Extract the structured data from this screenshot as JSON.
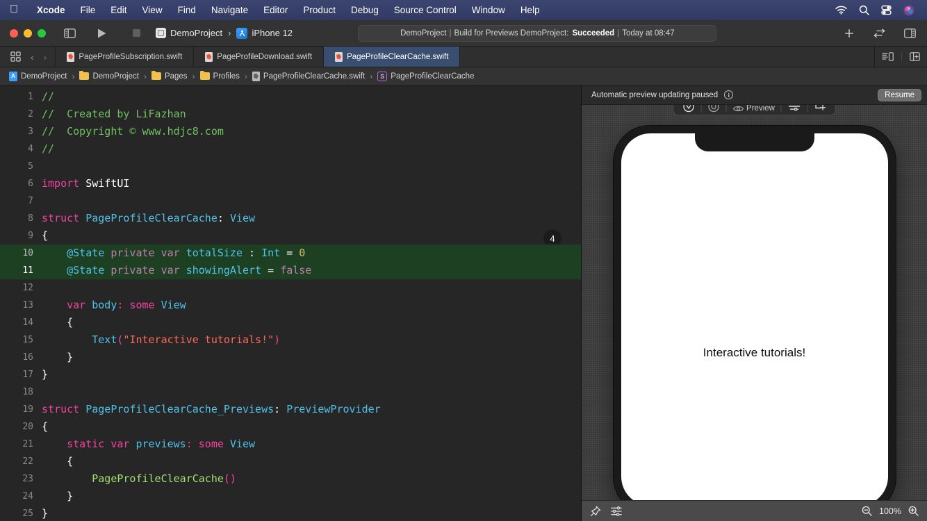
{
  "menubar": {
    "apple_icon": "apple-logo-icon",
    "items": [
      {
        "label": "Xcode",
        "bold": true
      },
      {
        "label": "File",
        "bold": false
      },
      {
        "label": "Edit",
        "bold": false
      },
      {
        "label": "View",
        "bold": false
      },
      {
        "label": "Find",
        "bold": false
      },
      {
        "label": "Navigate",
        "bold": false
      },
      {
        "label": "Editor",
        "bold": false
      },
      {
        "label": "Product",
        "bold": false
      },
      {
        "label": "Debug",
        "bold": false
      },
      {
        "label": "Source Control",
        "bold": false
      },
      {
        "label": "Window",
        "bold": false
      },
      {
        "label": "Help",
        "bold": false
      }
    ],
    "status_icons": [
      "wifi-icon",
      "search-icon",
      "control-center-icon",
      "siri-icon"
    ],
    "background": "#3b4570"
  },
  "toolbar": {
    "window_controls": [
      "close-button",
      "minimize-button",
      "zoom-button"
    ],
    "navigator_toggle": "sidebar-toggle-icon",
    "run_button": "run-icon",
    "stop_button": "stop-icon",
    "scheme_name": "DemoProject",
    "scheme_separator": "›",
    "destination_name": "iPhone 12",
    "status": {
      "project": "DemoProject",
      "sep1": "|",
      "action": "Build for Previews DemoProject:",
      "result": "Succeeded",
      "sep2": "|",
      "time": "Today at 08:47"
    },
    "right_buttons": [
      "add-editor-icon",
      "editor-options-icon",
      "inspector-toggle-icon"
    ]
  },
  "tabbar": {
    "grid_icon": "tab-overview-icon",
    "back_icon": "‹",
    "forward_icon": "›",
    "tabs": [
      {
        "label": "PageProfileSubscription.swift",
        "active": false
      },
      {
        "label": "PageProfileDownload.swift",
        "active": false
      },
      {
        "label": "PageProfileClearCache.swift",
        "active": true
      }
    ],
    "right_icons": [
      "minimap-toggle-icon",
      "split-editor-icon"
    ]
  },
  "breadcrumb": {
    "separator": "›",
    "items": [
      {
        "label": "DemoProject",
        "icon": "project-icon"
      },
      {
        "label": "DemoProject",
        "icon": "folder-icon"
      },
      {
        "label": "Pages",
        "icon": "folder-icon"
      },
      {
        "label": "Profiles",
        "icon": "folder-icon"
      },
      {
        "label": "PageProfileClearCache.swift",
        "icon": "swift-file-icon"
      },
      {
        "label": "PageProfileClearCache",
        "icon": "symbol-struct-icon"
      }
    ]
  },
  "editor": {
    "change_badge": "4",
    "lines": [
      {
        "n": "1",
        "diff": false,
        "html": "<span class='cmt'>//</span>"
      },
      {
        "n": "2",
        "diff": false,
        "html": "<span class='cmt'>//  Created by LiFazhan</span>"
      },
      {
        "n": "3",
        "diff": false,
        "html": "<span class='cmt'>//  Copyright © www.hdjc8.com</span>"
      },
      {
        "n": "4",
        "diff": false,
        "html": "<span class='cmt'>//</span>"
      },
      {
        "n": "5",
        "diff": false,
        "html": ""
      },
      {
        "n": "6",
        "diff": false,
        "html": "<span class='kw'>import</span> <span class='plain'>SwiftUI</span>"
      },
      {
        "n": "7",
        "diff": false,
        "html": ""
      },
      {
        "n": "8",
        "diff": false,
        "html": "<span class='kw'>struct</span> <span class='type'>PageProfileClearCache</span><span class='plain'>:</span> <span class='type'>View</span>"
      },
      {
        "n": "9",
        "diff": false,
        "html": "<span class='plain'>{</span>"
      },
      {
        "n": "10",
        "diff": true,
        "html": "    <span class='attr'>@State</span> <span class='kw2'>private</span> <span class='kw2'>var</span> <span class='type'>totalSize</span> <span class='plain'>:</span> <span class='type'>Int</span> <span class='plain'>=</span> <span class='num'>0</span>"
      },
      {
        "n": "11",
        "diff": true,
        "html": "    <span class='attr'>@State</span> <span class='kw2'>private</span> <span class='kw2'>var</span> <span class='type'>showingAlert</span> <span class='plain'>=</span> <span class='kw2'>false</span>"
      },
      {
        "n": "12",
        "diff": false,
        "html": ""
      },
      {
        "n": "13",
        "diff": false,
        "html": "    <span class='kw'>var</span> <span class='type'>body</span><span class='kw'>:</span> <span class='kw'>some</span> <span class='type'>View</span>"
      },
      {
        "n": "14",
        "diff": false,
        "html": "    <span class='plain'>{</span>"
      },
      {
        "n": "15",
        "diff": false,
        "html": "        <span class='type'>Text</span><span class='kw'>(</span><span class='str'>\"Interactive tutorials!\"</span><span class='kw'>)</span>"
      },
      {
        "n": "16",
        "diff": false,
        "html": "    <span class='plain'>}</span>"
      },
      {
        "n": "17",
        "diff": false,
        "html": "<span class='plain'>}</span>"
      },
      {
        "n": "18",
        "diff": false,
        "html": ""
      },
      {
        "n": "19",
        "diff": false,
        "html": "<span class='kw'>struct</span> <span class='type'>PageProfileClearCache_Previews</span><span class='plain'>:</span> <span class='type'>PreviewProvider</span>"
      },
      {
        "n": "20",
        "diff": false,
        "html": "<span class='plain'>{</span>"
      },
      {
        "n": "21",
        "diff": false,
        "html": "    <span class='kw'>static</span> <span class='kw'>var</span> <span class='type'>previews</span><span class='kw'>:</span> <span class='kw'>some</span> <span class='type'>View</span>"
      },
      {
        "n": "22",
        "diff": false,
        "html": "    <span class='plain'>{</span>"
      },
      {
        "n": "23",
        "diff": false,
        "html": "        <span class='fn'>PageProfileClearCache</span><span class='kw'>()</span>"
      },
      {
        "n": "24",
        "diff": false,
        "html": "    <span class='plain'>}</span>"
      },
      {
        "n": "25",
        "diff": false,
        "html": "<span class='plain'>}</span>"
      }
    ]
  },
  "preview": {
    "banner_text": "Automatic preview updating paused",
    "info_icon": "info-icon",
    "resume_label": "Resume",
    "floating_toolbar": {
      "live_icon": "live-preview-icon",
      "selectable_icon": "selectable-preview-icon",
      "label": "Preview",
      "preview_icon": "preview-eye-icon",
      "variants_icon": "preview-variants-icon",
      "add_icon": "add-preview-icon"
    },
    "device": "iPhone 12",
    "screen_text": "Interactive tutorials!",
    "bottom_bar": {
      "pin_icon": "pin-icon",
      "settings_icon": "preview-settings-icon",
      "zoom_out_icon": "zoom-out-icon",
      "zoom_level": "100%",
      "zoom_in_icon": "zoom-in-icon"
    }
  },
  "colors": {
    "menubar_bg": "#3b4570",
    "toolbar_bg": "#333333",
    "editor_bg": "#262626",
    "diff_added": "#1d4023",
    "tab_active": "#3a4f70",
    "preview_bg": "#3a3a3a"
  }
}
